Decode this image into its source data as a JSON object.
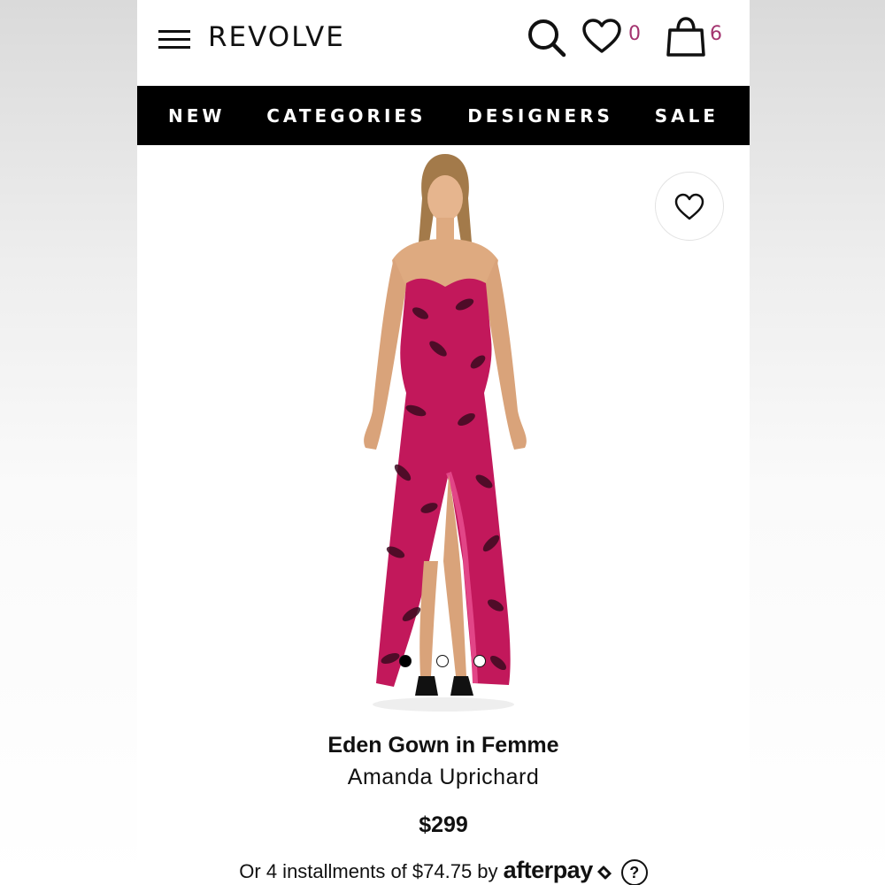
{
  "header": {
    "logo": "REVOLVE",
    "wishlist_count": "0",
    "bag_count": "6"
  },
  "nav": {
    "items": [
      "NEW",
      "CATEGORIES",
      "DESIGNERS",
      "SALE"
    ]
  },
  "product": {
    "name": "Eden Gown in Femme",
    "designer": "Amanda Uprichard",
    "price": "$299",
    "installments_text": "Or 4 installments of $74.75 by",
    "afterpay_label": "afterpay",
    "help_label": "?",
    "image_count": 3,
    "active_image_index": 0,
    "dress_color": "#c2185b"
  },
  "icons": {
    "menu": "hamburger-menu-icon",
    "search": "search-icon",
    "wishlist": "heart-icon",
    "bag": "shopping-bag-icon",
    "favorite": "heart-outline-icon"
  },
  "colors": {
    "badge": "#a3336f",
    "nav_bg": "#000000"
  }
}
